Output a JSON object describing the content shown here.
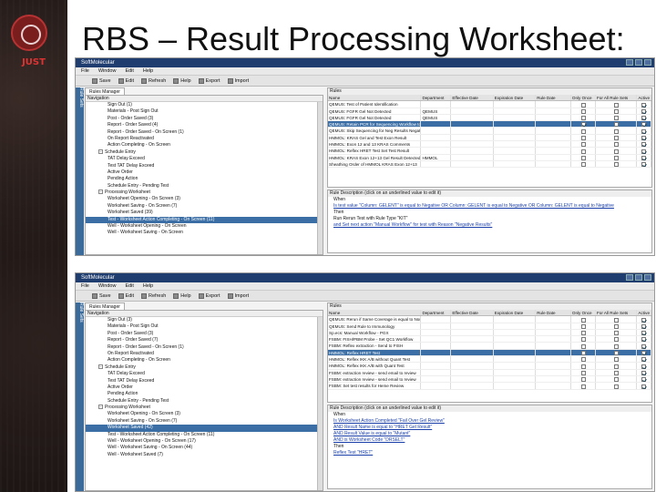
{
  "slide": {
    "title": "RBS – Result Processing Worksheet:",
    "logo_text": "JUST",
    "logo_sub": "",
    "vertical_caption": ""
  },
  "window": {
    "title": "SoftMolecular",
    "menu": [
      "File",
      "Window",
      "Edit",
      "Help"
    ],
    "toolbar": [
      "Save",
      "Edit",
      "Refresh",
      "Help",
      "Export",
      "Import"
    ],
    "side_tab": "Rule Sets",
    "manager_tab": "Rules Manager",
    "nav_header": "Navigation",
    "rules_header": "Rules",
    "desc_header": "Rule Description (click on an underlined value to edit it)"
  },
  "grid_columns": [
    "Name",
    "Department",
    "Effective Date",
    "Expiration Date",
    "Rule Date",
    "Only Once",
    "For All Rule Sets",
    "Active"
  ],
  "shot1": {
    "tree": [
      {
        "label": "Sign Out (1)",
        "indent": 2,
        "exp": false,
        "sel": false
      },
      {
        "label": "Materials - Post Sign Out",
        "indent": 2,
        "exp": false,
        "sel": false
      },
      {
        "label": "Post - Order Saved (3)",
        "indent": 2,
        "exp": false,
        "sel": false
      },
      {
        "label": "Report - Order Saved (4)",
        "indent": 2,
        "exp": false,
        "sel": false
      },
      {
        "label": "Report - Order Saved - On Screen (1)",
        "indent": 2,
        "exp": false,
        "sel": false
      },
      {
        "label": "On Report Reactivated",
        "indent": 2,
        "exp": false,
        "sel": false
      },
      {
        "label": "Action Completing - On Screen",
        "indent": 2,
        "exp": false,
        "sel": false
      },
      {
        "label": "Schedule Entry",
        "indent": 1,
        "exp": true,
        "sel": false
      },
      {
        "label": "TAT Delay Exceed",
        "indent": 2,
        "exp": false,
        "sel": false
      },
      {
        "label": "Test TAT Delay Exceed",
        "indent": 2,
        "exp": false,
        "sel": false
      },
      {
        "label": "Active Order",
        "indent": 2,
        "exp": false,
        "sel": false
      },
      {
        "label": "Pending Action",
        "indent": 2,
        "exp": false,
        "sel": false
      },
      {
        "label": "Schedule Entry - Pending Test",
        "indent": 2,
        "exp": false,
        "sel": false
      },
      {
        "label": "Processing Worksheet",
        "indent": 1,
        "exp": true,
        "sel": false
      },
      {
        "label": "Worksheet Opening - On Screen (3)",
        "indent": 2,
        "exp": false,
        "sel": false
      },
      {
        "label": "Worksheet Saving - On Screen (7)",
        "indent": 2,
        "exp": false,
        "sel": false
      },
      {
        "label": "Worksheet Saved (39)",
        "indent": 2,
        "exp": false,
        "sel": false
      },
      {
        "label": "Test - Worksheet Action Completing - On Screen (11)",
        "indent": 2,
        "exp": false,
        "sel": true
      },
      {
        "label": "Well - Worksheet Opening - On Screen",
        "indent": 2,
        "exp": false,
        "sel": false
      },
      {
        "label": "Well - Worksheet Saving - On Screen",
        "indent": 2,
        "exp": false,
        "sel": false
      }
    ],
    "rows": [
      {
        "name": "QEMUS: Test of Patient Identification",
        "dept": "",
        "oo": false,
        "fa": false,
        "act": true,
        "sel": false
      },
      {
        "name": "QEMUS: FGFR Gel Not Detected",
        "dept": "QEMUS",
        "oo": false,
        "fa": false,
        "act": true,
        "sel": false
      },
      {
        "name": "QEMUS: FGFR Gel Not Detected",
        "dept": "QEMUS",
        "oo": false,
        "fa": false,
        "act": true,
        "sel": false
      },
      {
        "name": "QEMUS: Retain PCR for Sequencing Workflow to ...",
        "dept": "",
        "oo": true,
        "fa": false,
        "act": true,
        "sel": true
      },
      {
        "name": "QEMUS: Skip Sequencing for Neg Results Negative",
        "dept": "",
        "oo": false,
        "fa": false,
        "act": true,
        "sel": false
      },
      {
        "name": "HMMOL: KRAS Gel and Test Exon Result",
        "dept": "",
        "oo": false,
        "fa": false,
        "act": true,
        "sel": false
      },
      {
        "name": "HMMOL: Exon 12 and 13 KRAS Comments",
        "dept": "",
        "oo": false,
        "fa": false,
        "act": true,
        "sel": false
      },
      {
        "name": "HMMOL: Reflex HRET Test Set Test Result",
        "dept": "",
        "oo": false,
        "fa": false,
        "act": true,
        "sel": false
      },
      {
        "name": "HMMOL: KRAS Exon 12+13 Gel Result Detected",
        "dept": "HMMOL",
        "oo": false,
        "fa": false,
        "act": true,
        "sel": false
      },
      {
        "name": "Sheathing Order of HMMOL KRAS Exon 12+13",
        "dept": "",
        "oo": false,
        "fa": false,
        "act": true,
        "sel": false
      }
    ],
    "desc": [
      {
        "t": "When",
        "cls": ""
      },
      {
        "t": "Is test value \"Column: GELENT\" is equal to Negative OR Column: GELENT is equal to Negative OR Column: GELENT is equal to Negative",
        "cls": "lnk"
      },
      {
        "t": "Then",
        "cls": ""
      },
      {
        "t": "Run Rerun Test with Rule Type \"KIT\"",
        "cls": ""
      },
      {
        "t": "and Set next action \"Manual Workflow\" for test with Reason \"Negative Results\"",
        "cls": "lnk"
      }
    ]
  },
  "shot2": {
    "tree": [
      {
        "label": "Sign Out (3)",
        "indent": 2,
        "exp": false,
        "sel": false
      },
      {
        "label": "Materials - Post Sign Out",
        "indent": 2,
        "exp": false,
        "sel": false
      },
      {
        "label": "Post - Order Saved (3)",
        "indent": 2,
        "exp": false,
        "sel": false
      },
      {
        "label": "Report - Order Saved (7)",
        "indent": 2,
        "exp": false,
        "sel": false
      },
      {
        "label": "Report - Order Saved - On Screen (1)",
        "indent": 2,
        "exp": false,
        "sel": false
      },
      {
        "label": "On Report Reactivated",
        "indent": 2,
        "exp": false,
        "sel": false
      },
      {
        "label": "Action Completing - On Screen",
        "indent": 2,
        "exp": false,
        "sel": false
      },
      {
        "label": "Schedule Entry",
        "indent": 1,
        "exp": true,
        "sel": false
      },
      {
        "label": "TAT Delay Exceed",
        "indent": 2,
        "exp": false,
        "sel": false
      },
      {
        "label": "Test TAT Delay Exceed",
        "indent": 2,
        "exp": false,
        "sel": false
      },
      {
        "label": "Active Order",
        "indent": 2,
        "exp": false,
        "sel": false
      },
      {
        "label": "Pending Action",
        "indent": 2,
        "exp": false,
        "sel": false
      },
      {
        "label": "Schedule Entry - Pending Test",
        "indent": 2,
        "exp": false,
        "sel": false
      },
      {
        "label": "Processing Worksheet",
        "indent": 1,
        "exp": true,
        "sel": false
      },
      {
        "label": "Worksheet Opening - On Screen (3)",
        "indent": 2,
        "exp": false,
        "sel": false
      },
      {
        "label": "Worksheet Saving - On Screen (7)",
        "indent": 2,
        "exp": false,
        "sel": false
      },
      {
        "label": "Worksheet Saved (42)",
        "indent": 2,
        "exp": false,
        "sel": true
      },
      {
        "label": "Test - Worksheet Action Completing - On Screen (11)",
        "indent": 2,
        "exp": false,
        "sel": false
      },
      {
        "label": "Well - Worksheet Opening - On Screen (17)",
        "indent": 2,
        "exp": false,
        "sel": false
      },
      {
        "label": "Well - Worksheet Saving - On Screen (44)",
        "indent": 2,
        "exp": false,
        "sel": false
      },
      {
        "label": "Well - Worksheet Saved (7)",
        "indent": 2,
        "exp": false,
        "sel": false
      }
    ],
    "rows": [
      {
        "name": "QEMUS: Rerun if Same Coverage is equal to Nor",
        "dept": "",
        "oo": false,
        "fa": false,
        "act": true,
        "sel": false
      },
      {
        "name": "QEMUS: Send Rule to Immunology",
        "dept": "",
        "oo": false,
        "fa": false,
        "act": true,
        "sel": false
      },
      {
        "name": "Sp.ecs: Manual Workflow - PGX",
        "dept": "",
        "oo": false,
        "fa": false,
        "act": true,
        "sel": false
      },
      {
        "name": "FSBM: FISH/PBM Probe - Set QC1 Workflow",
        "dept": "",
        "oo": false,
        "fa": false,
        "act": true,
        "sel": false
      },
      {
        "name": "FSBM: Reflex extraction - Send to FISH",
        "dept": "",
        "oo": false,
        "fa": false,
        "act": true,
        "sel": false
      },
      {
        "name": "HMMOL: Reflex HRET Test",
        "dept": "",
        "oo": false,
        "fa": false,
        "act": true,
        "sel": true
      },
      {
        "name": "HMMOL: Reflex IKK A/B without Quant Test",
        "dept": "",
        "oo": false,
        "fa": false,
        "act": true,
        "sel": false
      },
      {
        "name": "HMMOL: Reflex IKK A/B with Quant Test",
        "dept": "",
        "oo": false,
        "fa": false,
        "act": true,
        "sel": false
      },
      {
        "name": "FSBM: extraction review - send email to review",
        "dept": "",
        "oo": false,
        "fa": false,
        "act": true,
        "sel": false
      },
      {
        "name": "FSBM: extraction review - send email to review",
        "dept": "",
        "oo": false,
        "fa": false,
        "act": true,
        "sel": false
      },
      {
        "name": "FSBM: Set test results for Heme Review",
        "dept": "",
        "oo": false,
        "fa": false,
        "act": true,
        "sel": false
      }
    ],
    "desc": [
      {
        "t": "When",
        "cls": ""
      },
      {
        "t": "Is Worksheet Action Completed \"Fail Over Gel Review\"",
        "cls": "lnk"
      },
      {
        "t": "AND Result Name is equal to \"HRET Gel Result\"",
        "cls": "lnk"
      },
      {
        "t": "AND Result Value is equal to \"Mutant\"",
        "cls": "lnk"
      },
      {
        "t": "AND is Worksheet Code \"DRSELT\"",
        "cls": "lnk"
      },
      {
        "t": "Then",
        "cls": ""
      },
      {
        "t": "Reflex Test \"HRET\"",
        "cls": "lnk"
      }
    ]
  }
}
